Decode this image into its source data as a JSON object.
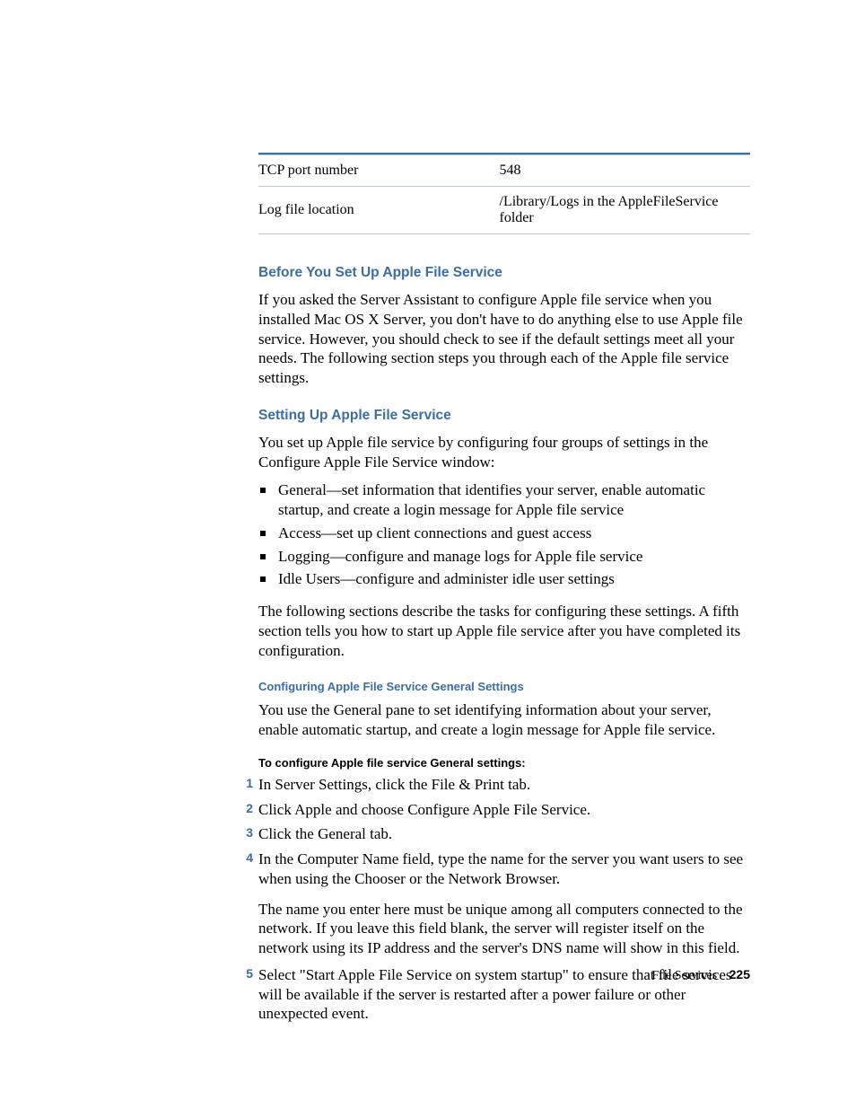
{
  "table": {
    "rows": [
      {
        "left": "TCP port number",
        "right": "548"
      },
      {
        "left": "Log file location",
        "right": "/Library/Logs in the AppleFileService folder"
      }
    ]
  },
  "sections": {
    "before": {
      "heading": "Before You Set Up Apple File Service",
      "body": "If you asked the Server Assistant to configure Apple file service when you installed Mac OS X Server, you don't have to do anything else to use Apple file service. However, you should check to see if the default settings meet all your needs. The following section steps you through each of the Apple file service settings."
    },
    "setting_up": {
      "heading": "Setting Up Apple File Service",
      "intro": "You set up Apple file service by configuring four groups of settings in the Configure Apple File Service window:",
      "bullets": [
        "General—set information that identifies your server, enable automatic startup, and create a login message for Apple file service",
        "Access—set up client connections and guest access",
        "Logging—configure and manage logs for Apple file service",
        "Idle Users—configure and administer idle user settings"
      ],
      "outro": "The following sections describe the tasks for configuring these settings. A fifth section tells you how to start up Apple file service after you have completed its configuration."
    },
    "configuring": {
      "heading": "Configuring Apple File Service General Settings",
      "body": "You use the General pane to set identifying information about your server, enable automatic startup, and create a login message for Apple file service."
    },
    "steps": {
      "heading": "To configure Apple file service General settings:",
      "items": [
        {
          "n": "1",
          "text": "In Server Settings, click the File & Print tab."
        },
        {
          "n": "2",
          "text": "Click Apple and choose Configure Apple File Service."
        },
        {
          "n": "3",
          "text": "Click the General tab."
        },
        {
          "n": "4",
          "text": "In the Computer Name field, type the name for the server you want users to see when using the Chooser or the Network Browser.",
          "sub": "The name you enter here must be unique among all computers connected to the network. If you leave this field blank, the server will register itself on the network using its IP address and the server's DNS name will show in this field."
        },
        {
          "n": "5",
          "text": "Select \"Start Apple File Service on system startup\" to ensure that file services will be available if the server is restarted after a power failure or other unexpected event."
        }
      ]
    }
  },
  "footer": {
    "section": "File Services",
    "page": "225"
  }
}
